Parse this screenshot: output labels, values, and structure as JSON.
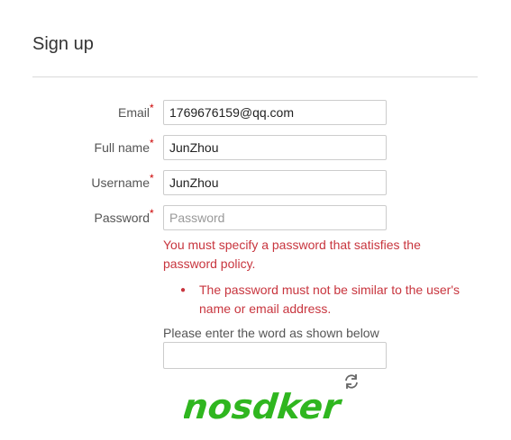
{
  "page": {
    "title": "Sign up"
  },
  "form": {
    "email": {
      "label": "Email",
      "required": "*",
      "value": "1769676159@qq.com"
    },
    "fullname": {
      "label": "Full name",
      "required": "*",
      "value": "JunZhou"
    },
    "username": {
      "label": "Username",
      "required": "*",
      "value": "JunZhou"
    },
    "password": {
      "label": "Password",
      "required": "*",
      "value": "",
      "placeholder": "Password"
    },
    "error": {
      "message": "You must specify a password that satisfies the password policy.",
      "items": [
        "The password must not be similar to the user's name or email address."
      ]
    },
    "captcha": {
      "label": "Please enter the word as shown below",
      "value": "",
      "word": "nosdker",
      "refresh_icon": "refresh-icon",
      "word_color": "#2fb61f"
    }
  },
  "colors": {
    "error": "#c8353e",
    "required": "#cc0000",
    "border": "#cccccc"
  }
}
